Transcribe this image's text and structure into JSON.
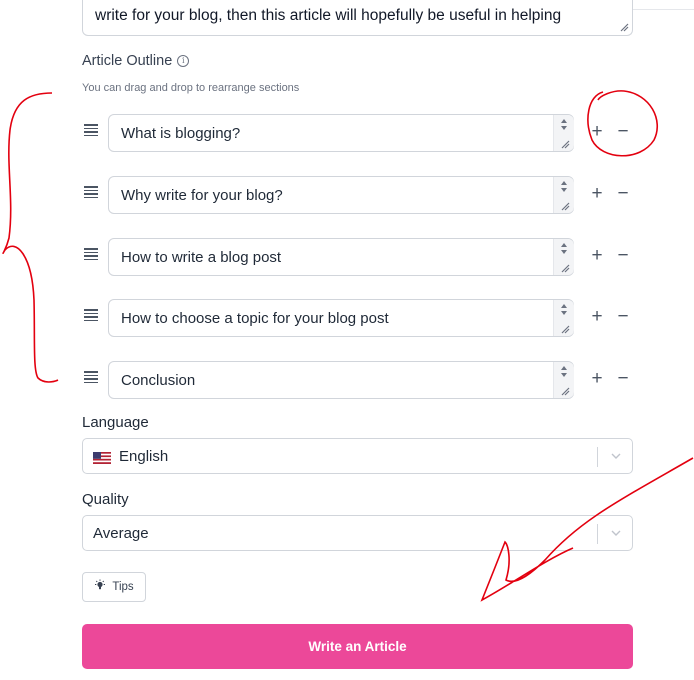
{
  "intro": {
    "text": "write for your blog, then this article will hopefully be useful in helping"
  },
  "outline": {
    "title": "Article Outline",
    "hint": "You can drag and drop to rearrange sections",
    "info_icon": "info-icon",
    "items": [
      {
        "label": "What is blogging?"
      },
      {
        "label": "Why write for your blog?"
      },
      {
        "label": "How to write a blog post"
      },
      {
        "label": "How to choose a topic for your blog post"
      },
      {
        "label": "Conclusion"
      }
    ],
    "add_symbol": "+",
    "remove_symbol": "−"
  },
  "language": {
    "label": "Language",
    "value": "English",
    "flag_icon": "us-flag-icon"
  },
  "quality": {
    "label": "Quality",
    "value": "Average"
  },
  "tips": {
    "label": "Tips",
    "icon": "lightbulb-icon"
  },
  "submit": {
    "label": "Write an Article",
    "color": "#ec4899"
  },
  "annotation_color": "#e3000f"
}
